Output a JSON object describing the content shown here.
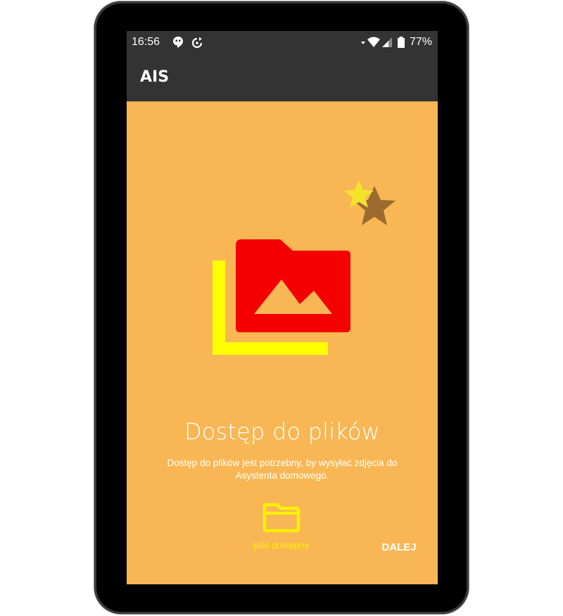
{
  "statusbar": {
    "time": "16:56",
    "battery": "77%",
    "icons": [
      "hangouts-icon",
      "sync-icon",
      "wifi-icon",
      "signal-icon",
      "battery-icon"
    ]
  },
  "appbar": {
    "title": "AIS"
  },
  "onboarding": {
    "title": "Dostęp do plików",
    "description": "Dostęp do plików jest potrzebny, by wysyłać zdjęcia do Asystenta domowego.",
    "status_label": "pliki dostępne",
    "next_label": "DALEJ"
  },
  "colors": {
    "background": "#F8B754",
    "bar": "#333333",
    "folder_red": "#F50000",
    "accent_yellow": "#FFFF00",
    "star_gold": "#F5E32A",
    "star_brown": "#9B6B30"
  }
}
